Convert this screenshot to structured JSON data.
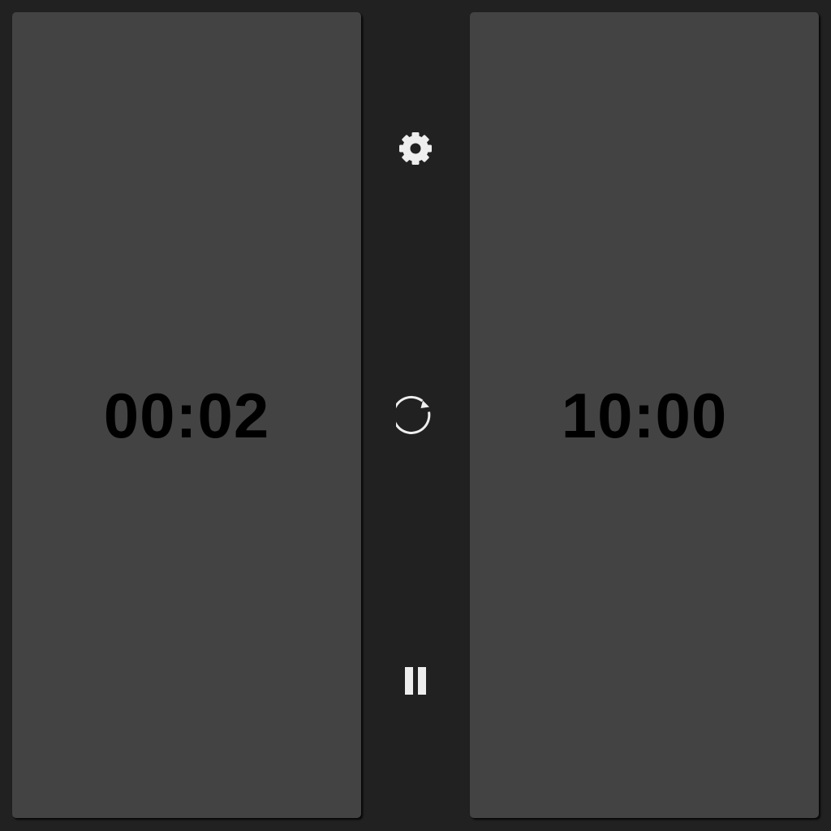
{
  "clocks": {
    "left": {
      "time": "00:02"
    },
    "right": {
      "time": "10:00"
    }
  },
  "controls": {
    "settings": {
      "icon": "gear-icon"
    },
    "reset": {
      "icon": "refresh-icon"
    },
    "pause": {
      "icon": "pause-icon"
    }
  },
  "colors": {
    "background": "#212121",
    "panel": "#434343",
    "time_text": "#000000",
    "icon": "#eeeeee"
  }
}
